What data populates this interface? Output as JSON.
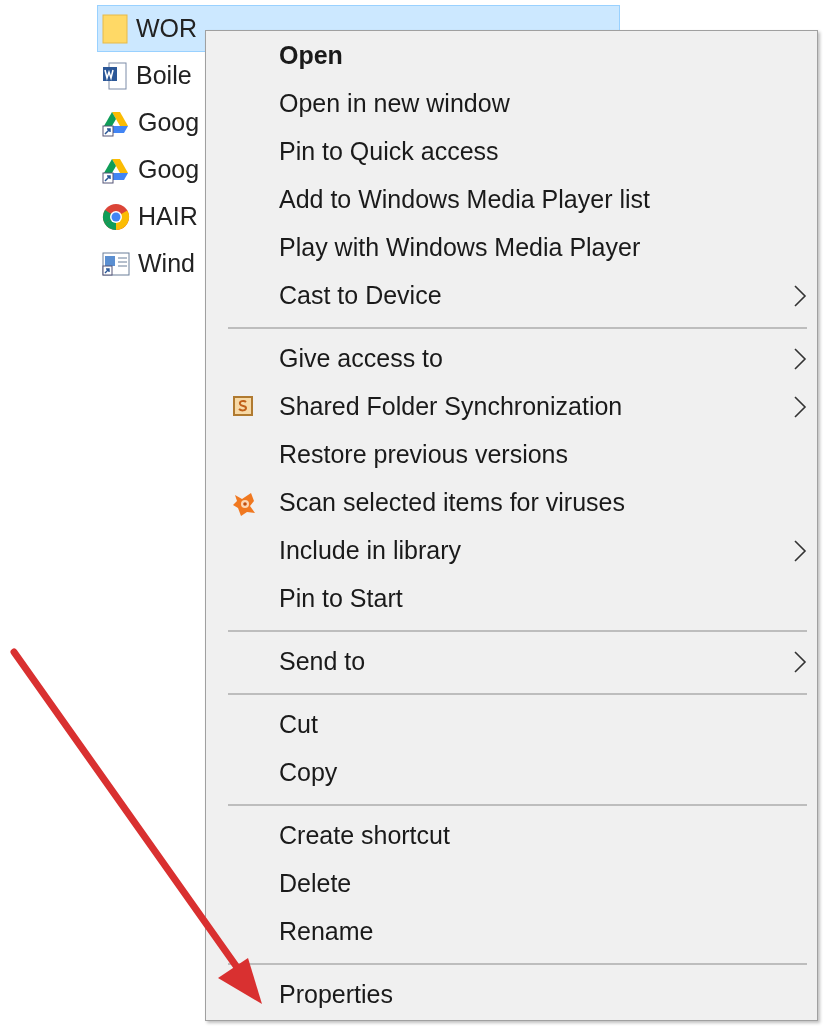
{
  "files": [
    {
      "label": "WOR",
      "kind": "folder",
      "selected": true
    },
    {
      "label": "Boile",
      "kind": "word",
      "selected": false
    },
    {
      "label": "Goog",
      "kind": "drive",
      "selected": false
    },
    {
      "label": "Goog",
      "kind": "drive",
      "selected": false
    },
    {
      "label": "HAIR",
      "kind": "chrome",
      "selected": false
    },
    {
      "label": "Wind",
      "kind": "app",
      "selected": false
    }
  ],
  "context_menu": {
    "groups": [
      [
        {
          "label": "Open",
          "bold": true,
          "submenu": false
        },
        {
          "label": "Open in new window",
          "bold": false,
          "submenu": false
        },
        {
          "label": "Pin to Quick access",
          "bold": false,
          "submenu": false
        },
        {
          "label": "Add to Windows Media Player list",
          "bold": false,
          "submenu": false
        },
        {
          "label": "Play with Windows Media Player",
          "bold": false,
          "submenu": false
        },
        {
          "label": "Cast to Device",
          "bold": false,
          "submenu": true
        }
      ],
      [
        {
          "label": "Give access to",
          "bold": false,
          "submenu": true
        },
        {
          "label": "Shared Folder Synchronization",
          "bold": false,
          "submenu": true,
          "kind": "sync-app"
        },
        {
          "label": "Restore previous versions",
          "bold": false,
          "submenu": false
        },
        {
          "label": "Scan selected items for viruses",
          "bold": false,
          "submenu": false,
          "kind": "antivirus"
        },
        {
          "label": "Include in library",
          "bold": false,
          "submenu": true
        },
        {
          "label": "Pin to Start",
          "bold": false,
          "submenu": false
        }
      ],
      [
        {
          "label": "Send to",
          "bold": false,
          "submenu": true
        }
      ],
      [
        {
          "label": "Cut",
          "bold": false,
          "submenu": false
        },
        {
          "label": "Copy",
          "bold": false,
          "submenu": false
        }
      ],
      [
        {
          "label": "Create shortcut",
          "bold": false,
          "submenu": false
        },
        {
          "label": "Delete",
          "bold": false,
          "submenu": false
        },
        {
          "label": "Rename",
          "bold": false,
          "submenu": false
        }
      ],
      [
        {
          "label": "Properties",
          "bold": false,
          "submenu": false
        }
      ]
    ]
  }
}
